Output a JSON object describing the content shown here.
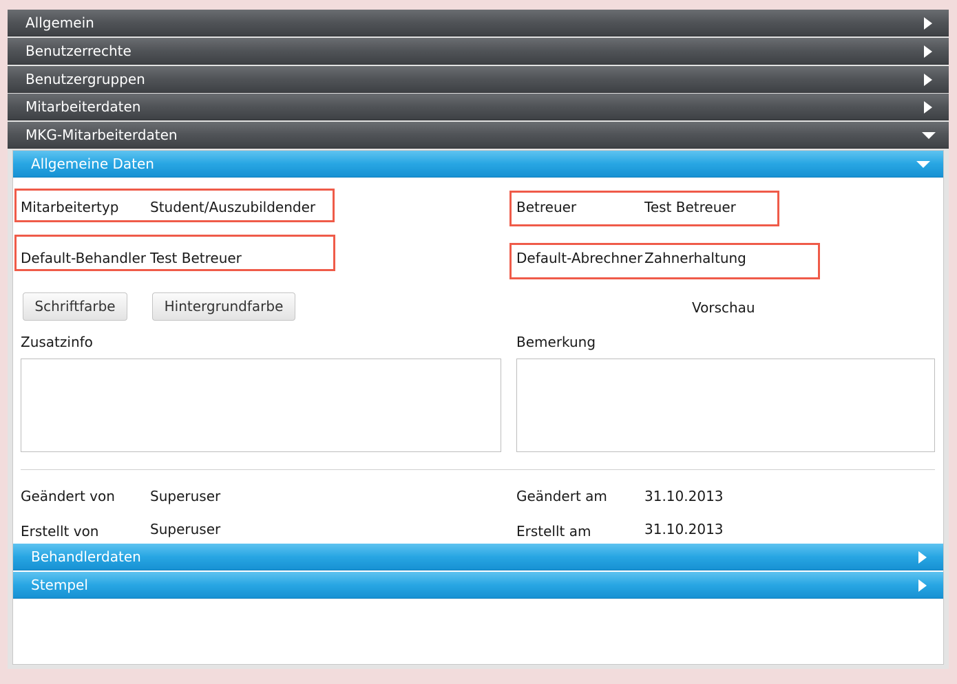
{
  "accordion": [
    {
      "label": "Allgemein"
    },
    {
      "label": "Benutzerrechte"
    },
    {
      "label": "Benutzergruppen"
    },
    {
      "label": "Mitarbeiterdaten"
    },
    {
      "label": "MKG-Mitarbeiterdaten"
    }
  ],
  "sections": {
    "allgemeine_daten": "Allgemeine Daten",
    "behandlerdaten": "Behandlerdaten",
    "stempel": "Stempel"
  },
  "fields": {
    "mitarbeitertyp": {
      "label": "Mitarbeitertyp",
      "value": "Student/Auszubildender"
    },
    "betreuer": {
      "label": "Betreuer",
      "value": "Test Betreuer"
    },
    "default_behandler": {
      "label": "Default-Behandler",
      "value": "Test Betreuer"
    },
    "default_abrechner": {
      "label": "Default-Abrechner",
      "value": "Zahnerhaltung"
    }
  },
  "buttons": {
    "schriftfarbe": "Schriftfarbe",
    "hintergrundfarbe": "Hintergrundfarbe"
  },
  "preview_label": "Vorschau",
  "zusatzinfo": {
    "label": "Zusatzinfo",
    "value": ""
  },
  "bemerkung": {
    "label": "Bemerkung",
    "value": ""
  },
  "meta": {
    "geaendert_von": {
      "label": "Geändert von",
      "value": "Superuser"
    },
    "erstellt_von": {
      "label": "Erstellt von",
      "value": "Superuser"
    },
    "geaendert_am": {
      "label": "Geändert am",
      "value": "31.10.2013"
    },
    "erstellt_am": {
      "label": "Erstellt am",
      "value": "31.10.2013"
    }
  },
  "colors": {
    "highlight": "#ef5b49",
    "dark_header": "#505357",
    "blue_header": "#28a6e3"
  }
}
